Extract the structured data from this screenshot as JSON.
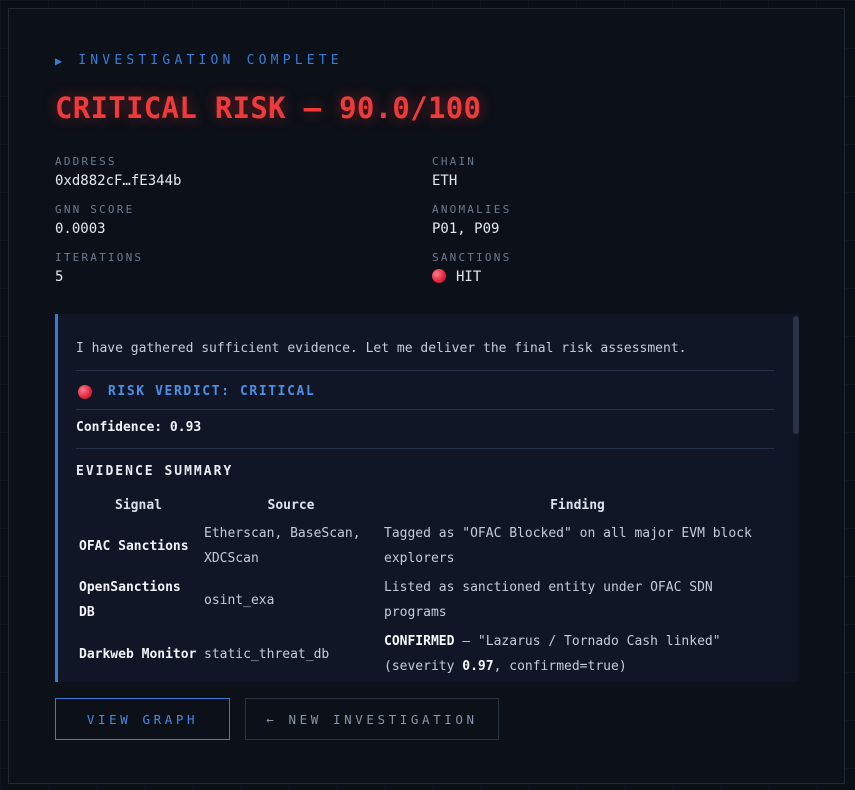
{
  "status": {
    "label": "INVESTIGATION COMPLETE"
  },
  "headline": "CRITICAL RISK — 90.0/100",
  "meta": {
    "address": {
      "label": "ADDRESS",
      "value": "0xd882cF…fE344b"
    },
    "chain": {
      "label": "CHAIN",
      "value": "ETH"
    },
    "gnn_score": {
      "label": "GNN SCORE",
      "value": "0.0003"
    },
    "anomalies": {
      "label": "ANOMALIES",
      "value": "P01, P09"
    },
    "iterations": {
      "label": "ITERATIONS",
      "value": "5"
    },
    "sanctions": {
      "label": "SANCTIONS",
      "value": "HIT"
    }
  },
  "report": {
    "intro": "I have gathered sufficient evidence. Let me deliver the final risk assessment.",
    "verdict": "RISK VERDICT: CRITICAL",
    "confidence_label": "Confidence:",
    "confidence_value": "0.93",
    "evidence_title": "EVIDENCE SUMMARY",
    "columns": [
      "Signal",
      "Source",
      "Finding"
    ],
    "rows": [
      {
        "signal": "OFAC Sanctions",
        "source": "Etherscan, BaseScan, XDCScan",
        "finding": "Tagged as \"OFAC Blocked\" on all major EVM block explorers"
      },
      {
        "signal": "OpenSanctions DB",
        "source": "osint_exa",
        "finding": "Listed as sanctioned entity under OFAC SDN programs"
      },
      {
        "signal": "Darkweb Monitor",
        "source": "static_threat_db",
        "finding_strong": "CONFIRMED",
        "finding_mid": " — \"Lazarus / Tornado Cash linked\" (severity ",
        "finding_sev": "0.97",
        "finding_end": ", confirmed=true)"
      }
    ]
  },
  "buttons": {
    "view_graph": "VIEW GRAPH",
    "new_investigation": "← NEW INVESTIGATION"
  },
  "colors": {
    "accent": "#3a7bd5",
    "critical": "#ef3a3a",
    "background": "#0c1018"
  }
}
